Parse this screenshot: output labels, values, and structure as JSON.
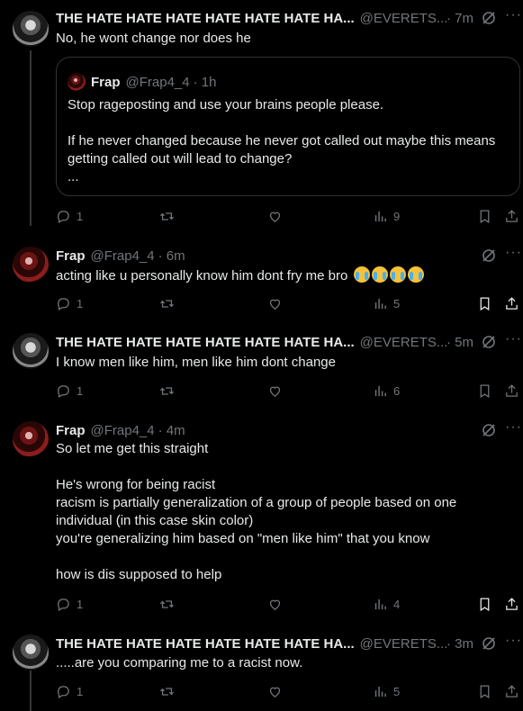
{
  "colors": {
    "background": "#000000",
    "text": "#e7e9ea",
    "muted": "#71767b",
    "border": "#2f3336"
  },
  "tweets": [
    {
      "name": "THE HATE HATE HATE HATE HATE HATE HA...",
      "handle": "@EVERETS...",
      "time": "· 7m",
      "body": [
        "No, he wont change nor does he"
      ],
      "quote": {
        "name": "Frap",
        "handle": "@Frap4_4",
        "time": "· 1h",
        "lines": [
          "Stop rageposting and use your brains people please.",
          "",
          "If he never changed because he never got called out maybe this means",
          "getting called out will lead to change?",
          "..."
        ]
      },
      "replies": "1",
      "views": "9"
    },
    {
      "name": "Frap",
      "handle": "@Frap4_4",
      "time": "· 6m",
      "body": [
        "acting like u personally know him dont fry me bro"
      ],
      "emoji": [
        "loudly-crying-face",
        "loudly-crying-face",
        "loudly-crying-face",
        "loudly-crying-face"
      ],
      "replies": "1",
      "views": "5"
    },
    {
      "name": "THE HATE HATE HATE HATE HATE HATE HA...",
      "handle": "@EVERETS...",
      "time": "· 5m",
      "body": [
        "I know men like him, men like him dont change"
      ],
      "replies": "1",
      "views": "6"
    },
    {
      "name": "Frap",
      "handle": "@Frap4_4",
      "time": "· 4m",
      "body": [
        "So let me get this straight",
        "",
        "He's wrong for being racist",
        "racism is partially generalization of a group of people based on one",
        "individual (in this case skin color)",
        "you're generalizing him based on \"men like him\" that you know",
        "",
        "how is dis supposed to help"
      ],
      "replies": "1",
      "views": "4"
    },
    {
      "name": "THE HATE HATE HATE HATE HATE HATE HA...",
      "handle": "@EVERETS...",
      "time": "· 3m",
      "body": [
        ".....are you comparing me to a racist now."
      ],
      "replies": "1",
      "views": "5"
    }
  ],
  "icons": {
    "reply": "reply-icon",
    "retweet": "retweet-icon",
    "like": "like-icon",
    "views": "views-icon",
    "bookmark": "bookmark-icon",
    "share": "share-icon",
    "grok": "grok-icon",
    "more": "more-icon"
  }
}
